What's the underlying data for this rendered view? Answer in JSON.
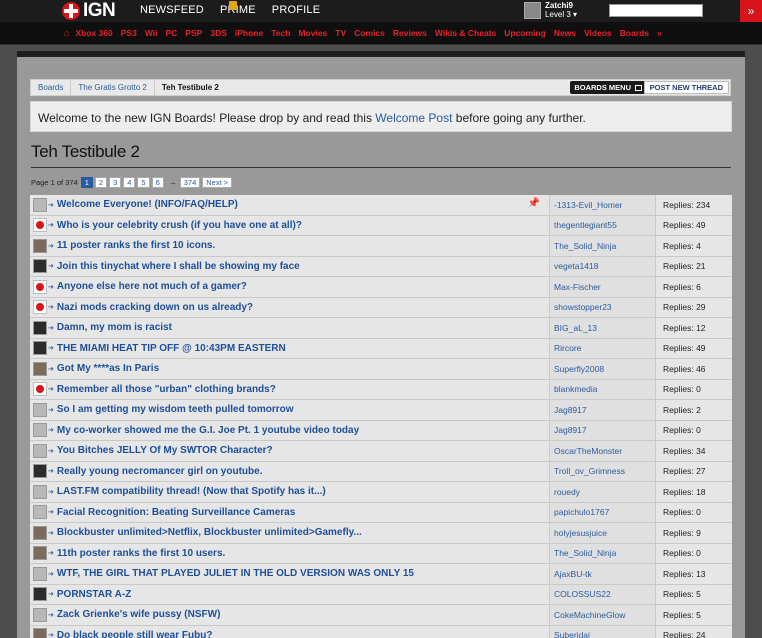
{
  "header": {
    "logo": "IGN",
    "nav": [
      "NEWSFEED",
      "PRIME",
      "PROFILE"
    ],
    "user": {
      "name": "Zatchi9",
      "level": "Level 3"
    }
  },
  "subnav": [
    "Xbox 360",
    "PS3",
    "Wii",
    "PC",
    "PSP",
    "3DS",
    "iPhone",
    "Tech",
    "Movies",
    "TV",
    "Comics",
    "Reviews",
    "Wikis & Cheats",
    "Upcoming",
    "News",
    "Videos",
    "Boards"
  ],
  "breadcrumb": {
    "items": [
      "Boards",
      "The Gratis Grotto 2",
      "Teh Testibule 2"
    ]
  },
  "buttons": {
    "boards_menu": "BOARDS MENU",
    "new_thread": "POST NEW THREAD"
  },
  "welcome": {
    "pre": "Welcome to the new IGN Boards! Please drop by and read this ",
    "link": "Welcome Post",
    "post": " before going any further."
  },
  "board_title": "Teh Testibule 2",
  "pager": {
    "info": "Page 1 of 374",
    "pages": [
      "1",
      "2",
      "3",
      "4",
      "5",
      "6"
    ],
    "arrow": "→",
    "last": "374",
    "next": "Next >"
  },
  "threads": [
    {
      "title": "Welcome Everyone! (INFO/FAQ/HELP)",
      "user": "-1313-Evil_Homer",
      "replies": "Replies: 234",
      "avatar": "light"
    },
    {
      "title": "Who is your celebrity crush (if you have one at all)?",
      "user": "thegentlegiant55",
      "replies": "Replies: 49",
      "avatar": "ign"
    },
    {
      "title": "11 poster ranks the first 10 icons.",
      "user": "The_Solid_Ninja",
      "replies": "Replies: 4",
      "avatar": "mid"
    },
    {
      "title": "Join this tinychat where I shall be showing my face",
      "user": "vegeta1418",
      "replies": "Replies: 21",
      "avatar": "dark"
    },
    {
      "title": "Anyone else here not much of a gamer?",
      "user": "Max-Fischer",
      "replies": "Replies: 6",
      "avatar": "ign"
    },
    {
      "title": "Nazi mods cracking down on us already?",
      "user": "showstopper23",
      "replies": "Replies: 29",
      "avatar": "ign"
    },
    {
      "title": "Damn, my mom is racist",
      "user": "BIG_aL_13",
      "replies": "Replies: 12",
      "avatar": "dark"
    },
    {
      "title": "THE MIAMI HEAT TIP OFF @ 10:43PM EASTERN",
      "user": "Rircore",
      "replies": "Replies: 49",
      "avatar": "dark"
    },
    {
      "title": "Got My ****as In Paris",
      "user": "Superfly2008",
      "replies": "Replies: 46",
      "avatar": "mid"
    },
    {
      "title": "Remember all those \"urban\" clothing brands?",
      "user": "blankmedia",
      "replies": "Replies: 0",
      "avatar": "ign"
    },
    {
      "title": "So I am getting my wisdom teeth pulled tomorrow",
      "user": "Jag8917",
      "replies": "Replies: 2",
      "avatar": "light"
    },
    {
      "title": "My co-worker showed me the G.I. Joe Pt. 1 youtube video today",
      "user": "Jag8917",
      "replies": "Replies: 0",
      "avatar": "light"
    },
    {
      "title": "You Bitches JELLY Of My SWTOR Character?",
      "user": "OscarTheMonster",
      "replies": "Replies: 34",
      "avatar": "light"
    },
    {
      "title": "Really young necromancer girl on youtube.",
      "user": "Troll_ov_Grimness",
      "replies": "Replies: 27",
      "avatar": "dark"
    },
    {
      "title": "LAST.FM compatibility thread! (Now that Spotify has it...)",
      "user": "rouedy",
      "replies": "Replies: 18",
      "avatar": "light"
    },
    {
      "title": "Facial Recognition: Beating Surveillance Cameras",
      "user": "papichulo1767",
      "replies": "Replies: 0",
      "avatar": "light"
    },
    {
      "title": "Blockbuster unlimited>Netflix, Blockbuster unlimited>Gamefly...",
      "user": "holyjesusjuice",
      "replies": "Replies: 9",
      "avatar": "mid"
    },
    {
      "title": "11th poster ranks the first 10 users.",
      "user": "The_Solid_Ninja",
      "replies": "Replies: 0",
      "avatar": "mid"
    },
    {
      "title": "WTF, THE GIRL THAT PLAYED JULIET IN THE OLD VERSION WAS ONLY 15",
      "user": "AjaxBU-tk",
      "replies": "Replies: 13",
      "avatar": "light"
    },
    {
      "title": "PORNSTAR A-Z",
      "user": "COLOSSUS22",
      "replies": "Replies: 5",
      "avatar": "dark"
    },
    {
      "title": "Zack Grienke's wife pussy (NSFW)",
      "user": "CokeMachineGlow",
      "replies": "Replies: 5",
      "avatar": "light"
    },
    {
      "title": "Do black people still wear Fubu?",
      "user": "Suberidai",
      "replies": "Replies: 24",
      "avatar": "mid"
    }
  ]
}
